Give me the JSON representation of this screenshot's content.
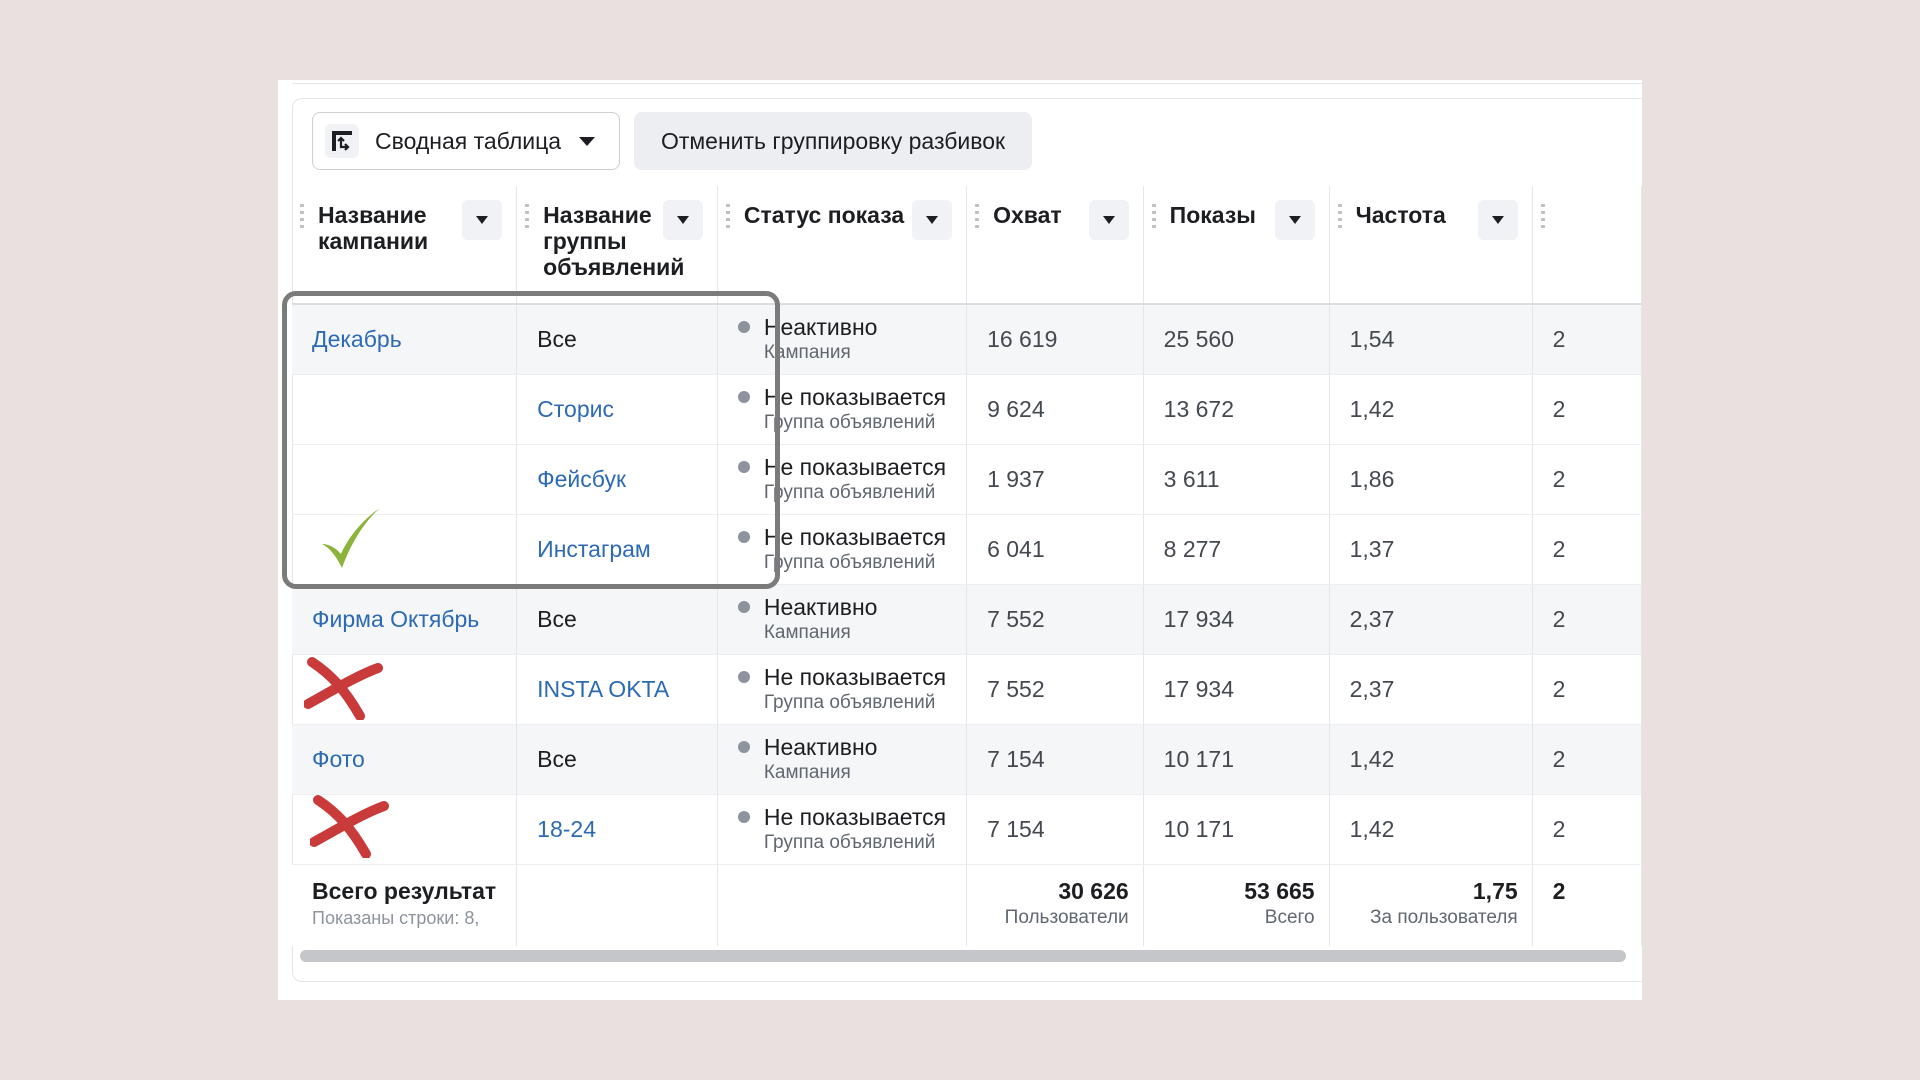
{
  "toolbar": {
    "pivot_label": "Сводная таблица",
    "ungroup_label": "Отменить группировку разбивок"
  },
  "columns": [
    {
      "label": "Название кампании"
    },
    {
      "label": "Название группы объявлений"
    },
    {
      "label": "Статус показа"
    },
    {
      "label": "Охват"
    },
    {
      "label": "Показы"
    },
    {
      "label": "Частота"
    }
  ],
  "rows": [
    {
      "campaign": "Декабрь",
      "adset": "Все",
      "status": "Неактивно",
      "level": "Кампания",
      "reach": "16 619",
      "impressions": "25 560",
      "frequency": "1,54",
      "next": "2"
    },
    {
      "campaign": "",
      "adset": "Сторис",
      "status": "Не показывается",
      "level": "Группа объявлений",
      "reach": "9 624",
      "impressions": "13 672",
      "frequency": "1,42",
      "next": "2"
    },
    {
      "campaign": "",
      "adset": "Фейсбук",
      "status": "Не показывается",
      "level": "Группа объявлений",
      "reach": "1 937",
      "impressions": "3 611",
      "frequency": "1,86",
      "next": "2"
    },
    {
      "campaign": "",
      "adset": "Инстаграм",
      "status": "Не показывается",
      "level": "Группа объявлений",
      "reach": "6 041",
      "impressions": "8 277",
      "frequency": "1,37",
      "next": "2"
    },
    {
      "campaign": "Фирма Октябрь",
      "adset": "Все",
      "status": "Неактивно",
      "level": "Кампания",
      "reach": "7 552",
      "impressions": "17 934",
      "frequency": "2,37",
      "next": "2"
    },
    {
      "campaign": "",
      "adset": "INSTA OKTA",
      "status": "Не показывается",
      "level": "Группа объявлений",
      "reach": "7 552",
      "impressions": "17 934",
      "frequency": "2,37",
      "next": "2"
    },
    {
      "campaign": "Фото",
      "adset": "Все",
      "status": "Неактивно",
      "level": "Кампания",
      "reach": "7 154",
      "impressions": "10 171",
      "frequency": "1,42",
      "next": "2"
    },
    {
      "campaign": "",
      "adset": "18-24",
      "status": "Не показывается",
      "level": "Группа объявлений",
      "reach": "7 154",
      "impressions": "10 171",
      "frequency": "1,42",
      "next": "2"
    }
  ],
  "totals": {
    "title": "Всего результат",
    "subtitle": "Показаны строки: 8,",
    "reach": "30 626",
    "reach_label": "Пользователи",
    "impressions": "53 665",
    "impressions_label": "Всего",
    "frequency": "1,75",
    "frequency_label": "За пользователя",
    "next": "2"
  },
  "annotations": {
    "check_color": "#8bb53a",
    "cross_color": "#c93a3a",
    "box_color": "#7b7b7b"
  }
}
